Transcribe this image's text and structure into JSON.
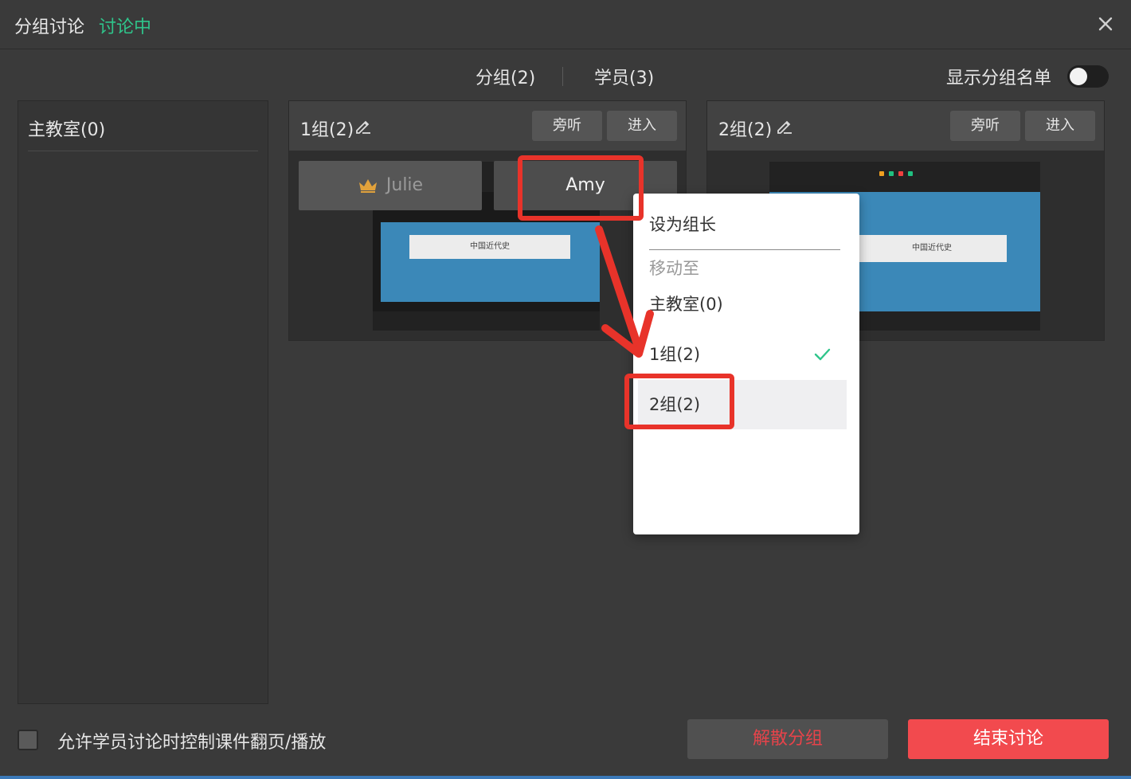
{
  "window": {
    "title": "分组讨论",
    "status": "讨论中",
    "close_icon": "close-icon"
  },
  "tabs": [
    {
      "label": "分组(2)"
    },
    {
      "label": "学员(3)"
    }
  ],
  "toggle": {
    "label": "显示分组名单",
    "on": false
  },
  "main_room": {
    "title": "主教室(0)"
  },
  "groups": [
    {
      "title": "1组(2)",
      "monitor_label": "旁听",
      "enter_label": "进入",
      "slide_title": "中国近代史",
      "members": [
        {
          "name": "Julie",
          "role": "leader"
        },
        {
          "name": "Amy",
          "role": "member"
        }
      ]
    },
    {
      "title": "2组(2)",
      "monitor_label": "旁听",
      "enter_label": "进入",
      "slide_title": "中国近代史"
    }
  ],
  "context_menu": {
    "set_leader": "设为组长",
    "move_to": "移动至",
    "items": [
      {
        "label": "主教室(0)"
      },
      {
        "label": "1组(2)",
        "checked": true
      },
      {
        "label": "2组(2)",
        "hovered": true
      }
    ]
  },
  "footer": {
    "checkbox_label": "允许学员讨论时控制课件翻页/播放",
    "dissolve_label": "解散分组",
    "end_label": "结束讨论"
  },
  "colors": {
    "accent_green": "#2fc58b",
    "danger_red": "#f24a4e",
    "highlight_red": "#e8332a"
  }
}
